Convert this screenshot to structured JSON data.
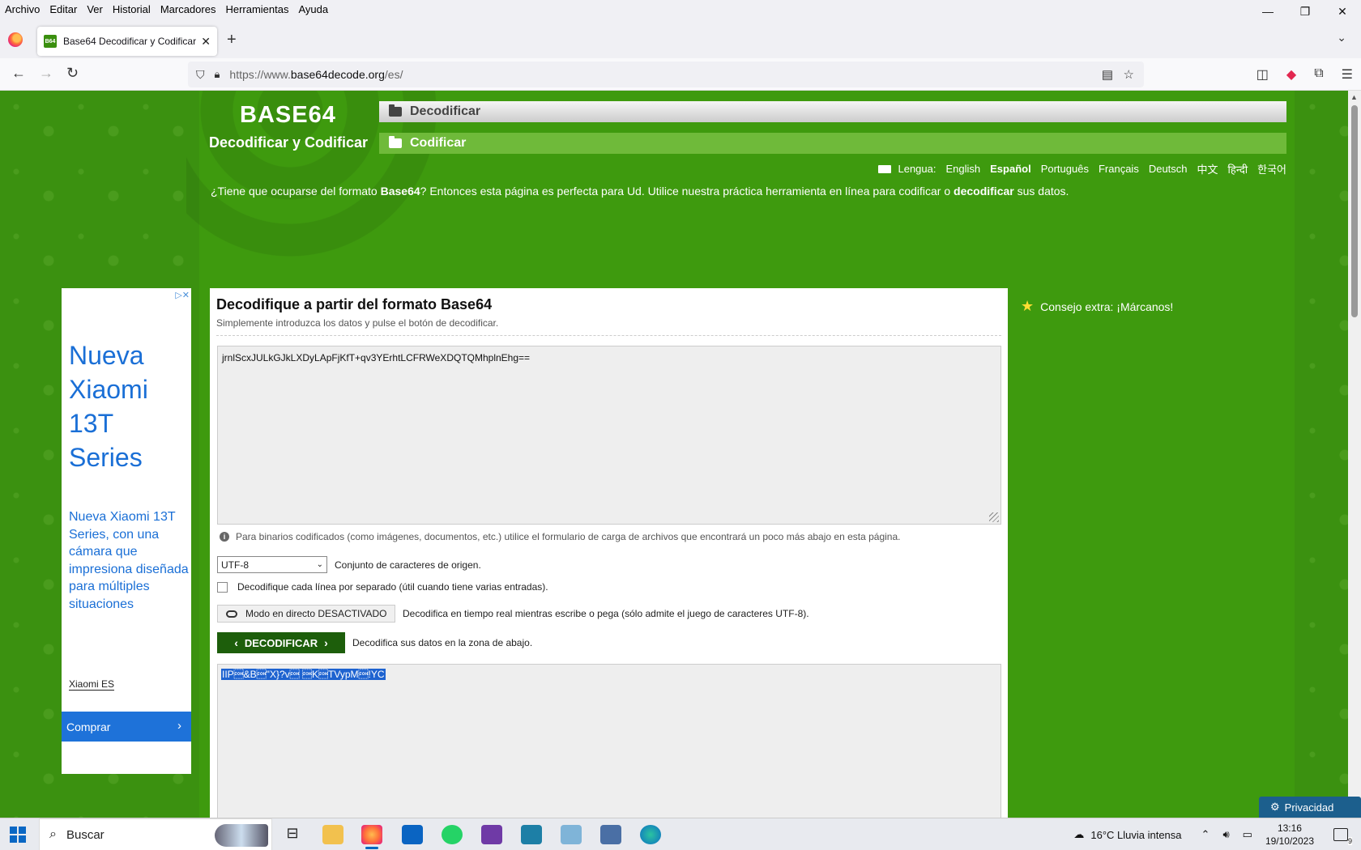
{
  "menu": [
    "Archivo",
    "Editar",
    "Ver",
    "Historial",
    "Marcadores",
    "Herramientas",
    "Ayuda"
  ],
  "window_controls": {
    "minimize": "—",
    "restore": "❐",
    "close": "✕"
  },
  "tab": {
    "favicon": "B64",
    "title": "Base64 Decodificar y Codificar",
    "close": "✕"
  },
  "newtab_label": "+",
  "url": {
    "prefix": "https://www.",
    "domain": "base64decode.org",
    "path": "/es/"
  },
  "site": {
    "logo_title": "BASE64",
    "logo_subtitle": "Decodificar y Codificar",
    "nav": {
      "decode": "Decodificar",
      "encode": "Codificar"
    },
    "lang_label": "Lengua:",
    "languages": [
      {
        "name": "English",
        "active": false
      },
      {
        "name": "Español",
        "active": true
      },
      {
        "name": "Português",
        "active": false
      },
      {
        "name": "Français",
        "active": false
      },
      {
        "name": "Deutsch",
        "active": false
      },
      {
        "name": "中文",
        "active": false
      },
      {
        "name": "हिन्दी",
        "active": false
      },
      {
        "name": "한국어",
        "active": false
      }
    ],
    "intro": {
      "part1": "¿Tiene que ocuparse del formato ",
      "bold1": "Base64",
      "part2": "? Entonces esta página es perfecta para Ud. Utilice nuestra práctica herramienta en línea para codificar o ",
      "bold2": "decodificar",
      "part3": " sus datos."
    }
  },
  "ad": {
    "title": "Nueva Xiaomi 13T Series",
    "text": "Nueva Xiaomi 13T Series, con una cámara que impresiona diseñada para múltiples situaciones",
    "brand": "Xiaomi ES",
    "cta": "Comprar",
    "cta_icon": "›"
  },
  "decoder": {
    "title": "Decodifique a partir del formato Base64",
    "subtitle": "Simplemente introduzca los datos y pulse el botón de decodificar.",
    "input_value": "jrnlScxJULkGJkLXDyLApFjKfT+qv3YErhtLCFRWeXDQTQMhplnEhg==",
    "hint": "Para binarios codificados (como imágenes, documentos, etc.) utilice el formulario de carga de archivos que encontrará un poco más abajo en esta página.",
    "charset": {
      "value": "UTF-8",
      "label": "Conjunto de caracteres de origen."
    },
    "per_line": {
      "checked": false,
      "label": "Decodifique cada línea por separado (útil cuando tiene varias entradas)."
    },
    "live": {
      "button": "Modo en directo DESACTIVADO",
      "label": "Decodifica en tiempo real mientras escribe o pega (sólo admite el juego de caracteres UTF-8)."
    },
    "decode": {
      "button": "DECODIFICAR",
      "label": "Decodifica sus datos en la zona de abajo."
    },
    "output_value": "IIP\u0001&B\u0001\"X}?v\u0001 \u0001K\u0001TVypM\u0001!YC"
  },
  "tip": "Consejo extra: ¡Márcanos!",
  "privacy": "Privacidad",
  "taskbar": {
    "search_placeholder": "Buscar",
    "weather": "16°C  Lluvia intensa",
    "time": "13:16",
    "date": "19/10/2023",
    "notifications": "9"
  },
  "colors": {
    "page_bg": "#3b9110",
    "decode_button": "#1d5e0b",
    "ad_blue": "#1a6fd6",
    "selection": "#1e63d0"
  }
}
